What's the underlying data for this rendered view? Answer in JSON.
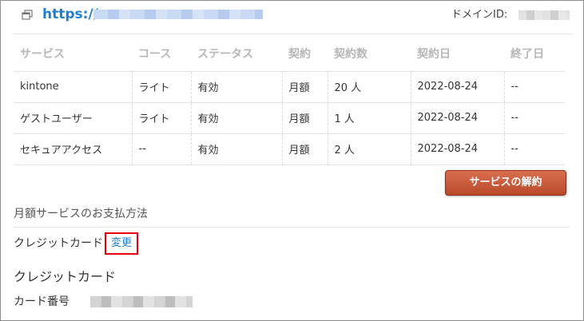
{
  "header": {
    "url_prefix": "https://",
    "domain_id_label": "ドメインID:"
  },
  "table": {
    "columns": [
      "サービス",
      "コース",
      "ステータス",
      "契約",
      "契約数",
      "契約日",
      "終了日"
    ],
    "rows": [
      [
        "kintone",
        "ライト",
        "有効",
        "月額",
        "20 人",
        "2022-08-24",
        "--"
      ],
      [
        "ゲストユーザー",
        "ライト",
        "有効",
        "月額",
        "1 人",
        "2022-08-24",
        "--"
      ],
      [
        "セキュアアクセス",
        "--",
        "有効",
        "月額",
        "2 人",
        "2022-08-24",
        "--"
      ]
    ]
  },
  "cancel_button": "サービスの解約",
  "payment": {
    "section_title": "月額サービスのお支払方法",
    "method_label": "クレジットカード",
    "change_link": "変更",
    "card_heading": "クレジットカード",
    "card_number_label": "カード番号"
  },
  "colors": {
    "link": "#1f7fd1",
    "button": "#c0502f",
    "highlight": "#e8000d"
  }
}
